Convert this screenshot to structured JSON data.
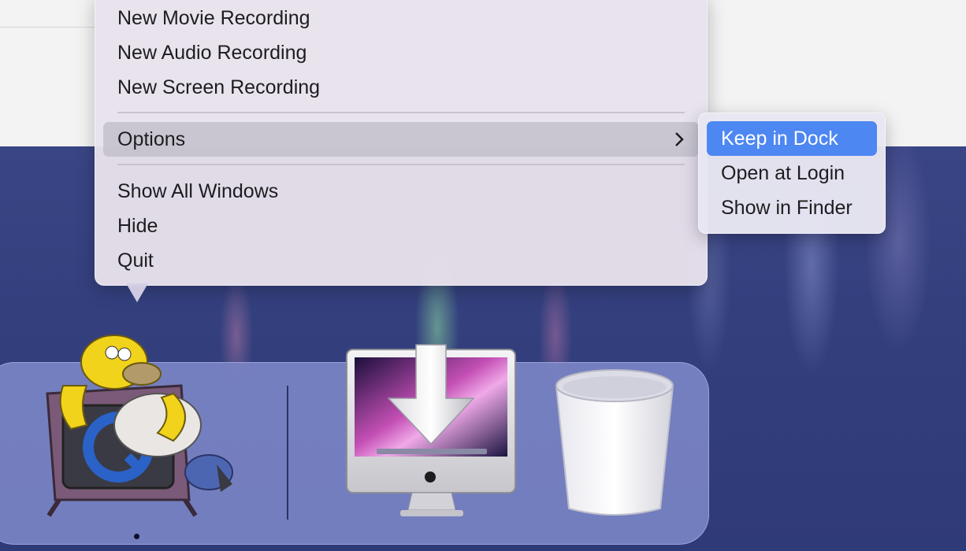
{
  "menu": {
    "items": [
      {
        "label": "New Movie Recording"
      },
      {
        "label": "New Audio Recording"
      },
      {
        "label": "New Screen Recording"
      },
      {
        "label": "Options",
        "submenu_indicator": "chevron-right-icon"
      },
      {
        "label": "Show All Windows"
      },
      {
        "label": "Hide"
      },
      {
        "label": "Quit"
      }
    ]
  },
  "submenu": {
    "items": [
      {
        "label": "Keep in Dock",
        "selected": true
      },
      {
        "label": "Open at Login"
      },
      {
        "label": "Show in Finder"
      }
    ]
  },
  "dock": {
    "apps": [
      {
        "icon": "quicktime-homer-icon",
        "running": true
      },
      {
        "icon": "mac-installer-download-icon",
        "running": false
      },
      {
        "icon": "trash-icon",
        "running": false
      }
    ]
  },
  "colors": {
    "highlight": "#4d87f2",
    "desktop": "#34407e",
    "dock": "#7a84c4"
  }
}
